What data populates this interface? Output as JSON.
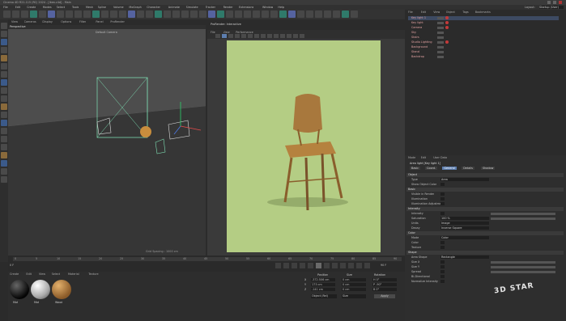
{
  "titlebar": {
    "text": "Cinema 4D R21.115 (RC) 2024 - [Ikea.c4d] - Main"
  },
  "menu": [
    "File",
    "Edit",
    "Create",
    "Modes",
    "Select",
    "Tools",
    "Mesh",
    "Spline",
    "Volume",
    "MoGraph",
    "Character",
    "Animate",
    "Simulate",
    "Tracker",
    "Render",
    "Extensions",
    "Window",
    "Help"
  ],
  "vp1": {
    "label": "Perspective",
    "tabs": [
      "View",
      "Cameras",
      "Display",
      "Options",
      "Filter",
      "Panel",
      "ProRender"
    ],
    "camera": "Default Camera",
    "spacing": "Grid Spacing : 1000 cm"
  },
  "vp2": {
    "title": "ProRender: Interactive",
    "tabs": [
      "File",
      "View",
      "Performance"
    ]
  },
  "timeline": {
    "frame_start": "0 F",
    "frame_end": "90 F",
    "marks": [
      "0",
      "5",
      "10",
      "15",
      "20",
      "25",
      "30",
      "35",
      "40",
      "45",
      "50",
      "55",
      "60",
      "65",
      "70",
      "75",
      "80",
      "85",
      "90"
    ]
  },
  "materials": {
    "menu": [
      "Create",
      "Edit",
      "View",
      "Select",
      "Material",
      "Texture"
    ],
    "items": [
      "Mat",
      "Mat",
      "Wood"
    ]
  },
  "coords": {
    "headers": [
      "Position",
      "Size",
      "Rotation"
    ],
    "rows": [
      {
        "axis": "X",
        "pos": "-372.506 cm",
        "size": "0 cm",
        "rot": "H 0°"
      },
      {
        "axis": "Y",
        "pos": "173 cm",
        "size": "0 cm",
        "rot": "P -90°"
      },
      {
        "axis": "Z",
        "pos": "-141 cm",
        "size": "0 cm",
        "rot": "B 0°"
      }
    ],
    "mode": "Object (Rel)",
    "sizemode": "Size",
    "apply": "Apply"
  },
  "objmgr": {
    "menu": [
      "File",
      "Edit",
      "View",
      "Object",
      "Tags",
      "Bookmarks"
    ],
    "layout_label": "Layout:",
    "layout_value": "Startup (User)",
    "objects": [
      "Key light 1",
      "Key light",
      "Camera",
      "Sky",
      "Stairs",
      "Studio Lighting",
      "Background",
      "Stand",
      "Backdrop"
    ]
  },
  "attrmgr": {
    "menu": [
      "Mode",
      "Edit",
      "User Data"
    ],
    "object_label": "Area light [Key light 1]",
    "tabs": [
      "Basic",
      "Coord.",
      "General",
      "Details",
      "Shadow"
    ],
    "sections": {
      "object": "Object",
      "basic": "Basic",
      "intensity": "Intensity",
      "color": "Color",
      "shape": "Shape"
    },
    "props": [
      {
        "label": "Type",
        "value": "Area"
      },
      {
        "label": "Show Object Color"
      },
      {
        "label": "Visible in Render"
      },
      {
        "label": "Illumination"
      },
      {
        "label": "Illumination Adjustment"
      },
      {
        "label": "Intensity"
      },
      {
        "label": "Saturation",
        "value": "100 %"
      },
      {
        "label": "Units",
        "value": "Image"
      },
      {
        "label": "Decay",
        "value": "Inverse Square"
      },
      {
        "label": "Mode",
        "value": "Color"
      },
      {
        "label": "Color"
      },
      {
        "label": "Texture"
      },
      {
        "label": "Area Shape",
        "value": "Rectangle"
      },
      {
        "label": "Size X"
      },
      {
        "label": "Size Y"
      },
      {
        "label": "Spread"
      },
      {
        "label": "Bi-Directional"
      },
      {
        "label": "Normalize Intensity"
      }
    ]
  },
  "watermark": "3D STAR"
}
